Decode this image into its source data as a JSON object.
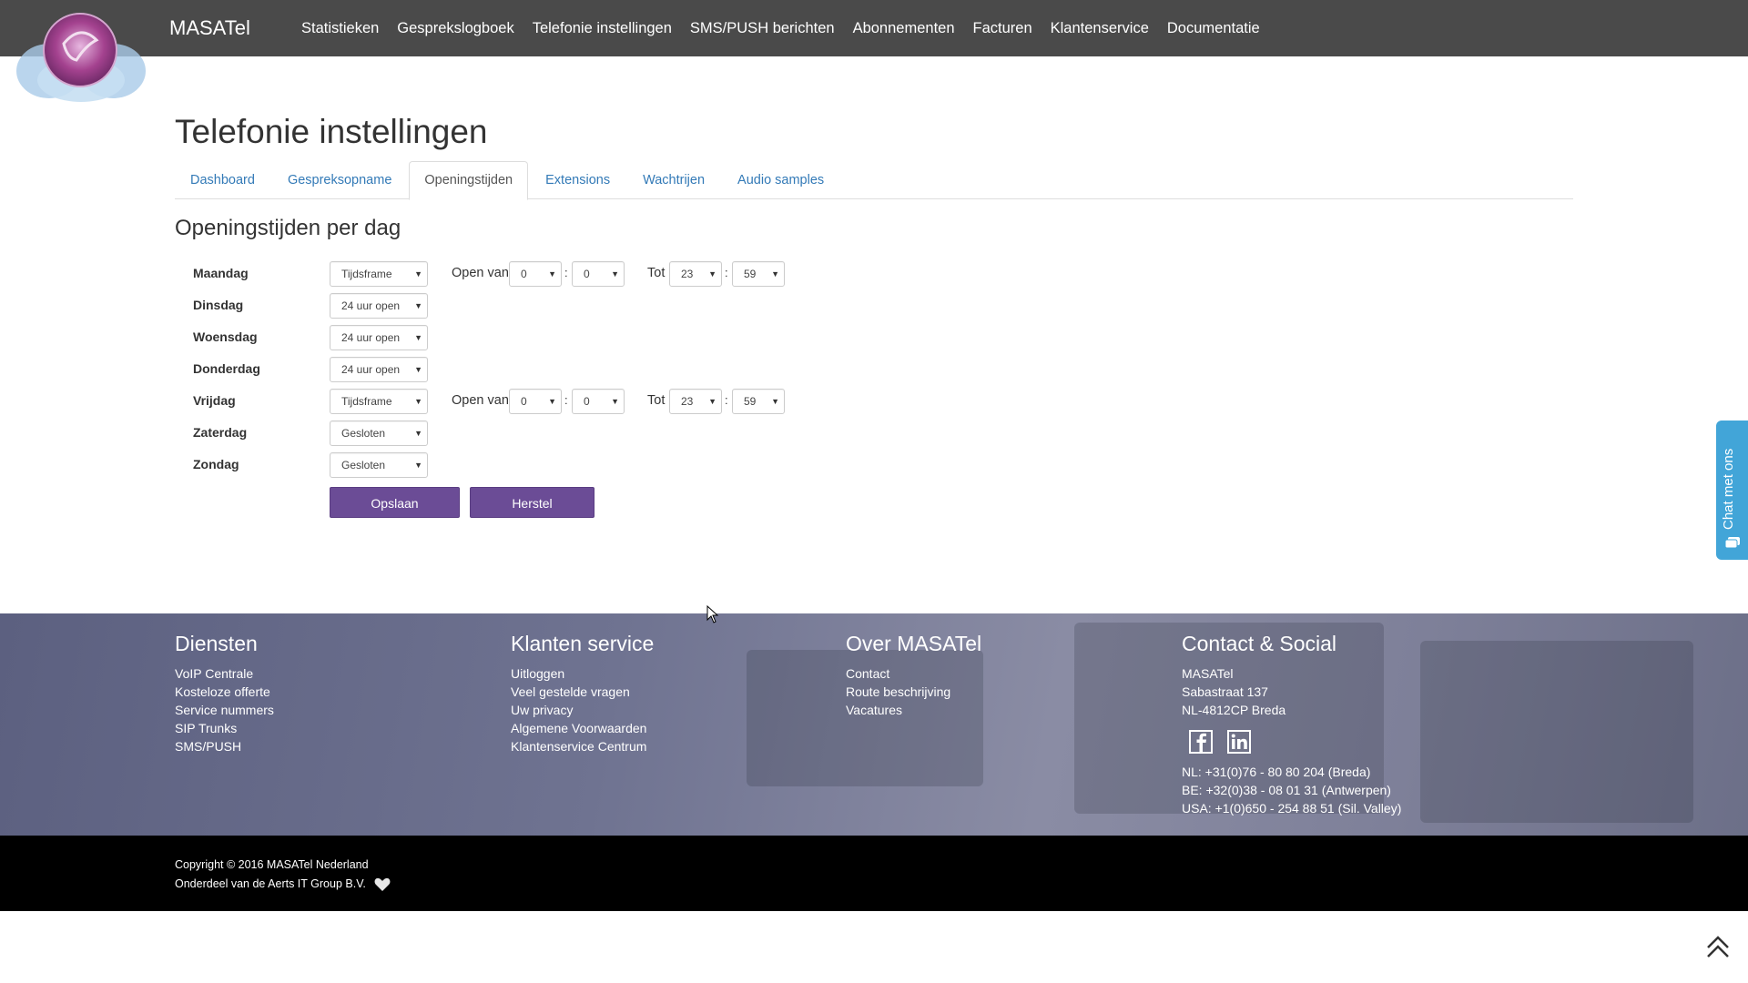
{
  "header": {
    "brand": "MASATel",
    "nav": [
      "Statistieken",
      "Gesprekslogboek",
      "Telefonie instellingen",
      "SMS/PUSH berichten",
      "Abonnementen",
      "Facturen",
      "Klantenservice",
      "Documentatie"
    ]
  },
  "page": {
    "title": "Telefonie instellingen",
    "tabs": [
      "Dashboard",
      "Gespreksopname",
      "Openingstijden",
      "Extensions",
      "Wachtrijen",
      "Audio samples"
    ],
    "active_tab": "Openingstijden",
    "section_title": "Openingstijden per dag"
  },
  "schedule": {
    "open_from_label": "Open van",
    "until_label": "Tot",
    "colon": ":",
    "days": [
      {
        "day": "Maandag",
        "mode": "Tijdsframe",
        "from_h": "0",
        "from_m": "0",
        "to_h": "23",
        "to_m": "59"
      },
      {
        "day": "Dinsdag",
        "mode": "24 uur open"
      },
      {
        "day": "Woensdag",
        "mode": "24 uur open"
      },
      {
        "day": "Donderdag",
        "mode": "24 uur open"
      },
      {
        "day": "Vrijdag",
        "mode": "Tijdsframe",
        "from_h": "0",
        "from_m": "0",
        "to_h": "23",
        "to_m": "59"
      },
      {
        "day": "Zaterdag",
        "mode": "Gesloten"
      },
      {
        "day": "Zondag",
        "mode": "Gesloten"
      }
    ],
    "save_label": "Opslaan",
    "reset_label": "Herstel"
  },
  "chat": {
    "label": "Chat met ons"
  },
  "footer": {
    "diensten": {
      "title": "Diensten",
      "links": [
        "VoIP Centrale",
        "Kosteloze offerte",
        "Service nummers",
        "SIP Trunks",
        "SMS/PUSH"
      ]
    },
    "klantenservice": {
      "title": "Klanten service",
      "links": [
        "Uitloggen",
        "Veel gestelde vragen",
        "Uw privacy",
        "Algemene Voorwaarden",
        "Klantenservice Centrum"
      ]
    },
    "over": {
      "title": "Over MASATel",
      "links": [
        "Contact",
        "Route beschrijving",
        "Vacatures"
      ]
    },
    "contact": {
      "title": "Contact & Social",
      "address": [
        "MASATel",
        "Sabastraat 137",
        "NL-4812CP Breda"
      ],
      "phones": [
        "NL: +31(0)76 - 80 80 204 (Breda)",
        "BE: +32(0)38 - 08 01 31 (Antwerpen)",
        "USA: +1(0)650 - 254 88 51 (Sil. Valley)"
      ]
    },
    "copyright": "Copyright © 2016 MASATel Nederland",
    "part_of": "Onderdeel van de Aerts IT Group B.V."
  },
  "icons": {
    "social": [
      "facebook-icon",
      "linkedin-icon"
    ],
    "accent": "#6b4c96",
    "chat_color": "#42a5d8"
  }
}
